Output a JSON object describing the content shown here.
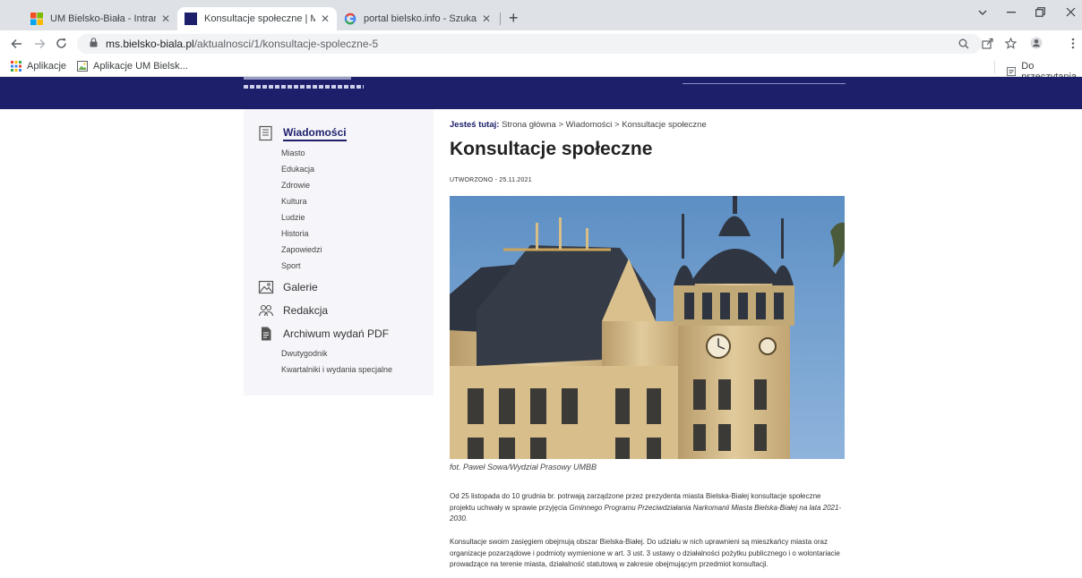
{
  "browser": {
    "tabs": [
      {
        "title": "UM Bielsko-Biała - Intranet",
        "close": "✕"
      },
      {
        "title": "Konsultacje społeczne | Magazyn",
        "close": "✕"
      },
      {
        "title": "portal bielsko.info - Szukaj w Goo",
        "close": "✕"
      }
    ],
    "new_tab": "+",
    "url_host": "ms.bielsko-biala.pl",
    "url_path": "/aktualnosci/1/konsultacje-spoleczne-5",
    "bookmarks": {
      "apps": "Aplikacje",
      "um_apps": "Aplikacje UM Bielsk...",
      "reading_list": "Do przeczytania"
    }
  },
  "sidebar": {
    "wiadomosci": "Wiadomości",
    "wiadomosci_sub": [
      "Miasto",
      "Edukacja",
      "Zdrowie",
      "Kultura",
      "Ludzie",
      "Historia",
      "Zapowiedzi",
      "Sport"
    ],
    "galerie": "Galerie",
    "redakcja": "Redakcja",
    "archiwum": "Archiwum wydań PDF",
    "archiwum_sub": [
      "Dwutygodnik",
      "Kwartalniki i wydania specjalne"
    ]
  },
  "article": {
    "breadcrumb_label": "Jesteś tutaj:",
    "breadcrumb_path": "Strona główna > Wiadomości > Konsultacje społeczne",
    "title": "Konsultacje społeczne",
    "created": "UTWORZONO - 25.11.2021",
    "caption": "fot. Paweł Sowa/Wydział Prasowy UMBB",
    "p1_lead": "Od 25 listopada do 10 grudnia br. potrwają zarządzone przez prezydenta miasta Bielska-Białej konsultacje społeczne projektu uchwały w sprawie przyjęcia ",
    "p1_italic": "Gminnego Programu Przeciwdziałania Narkomanii Miasta Bielska-Białej na lata 2021-2030.",
    "p2": "Konsultacje swoim zasięgiem obejmują obszar Bielska-Białej. Do udziału w nich uprawnieni są mieszkańcy miasta oraz organizacje pozarządowe i podmioty wymienione w art. 3 ust. 3 ustawy o działalności pożytku publicznego i o wolontariacie prowadzące na terenie miasta, działalność statutową w zakresie obejmującym przedmiot konsultacji."
  },
  "colors": {
    "header_navy": "#1d1f6b",
    "sidebar_bg": "#f6f6fa",
    "sky": "#6d9bc9"
  }
}
